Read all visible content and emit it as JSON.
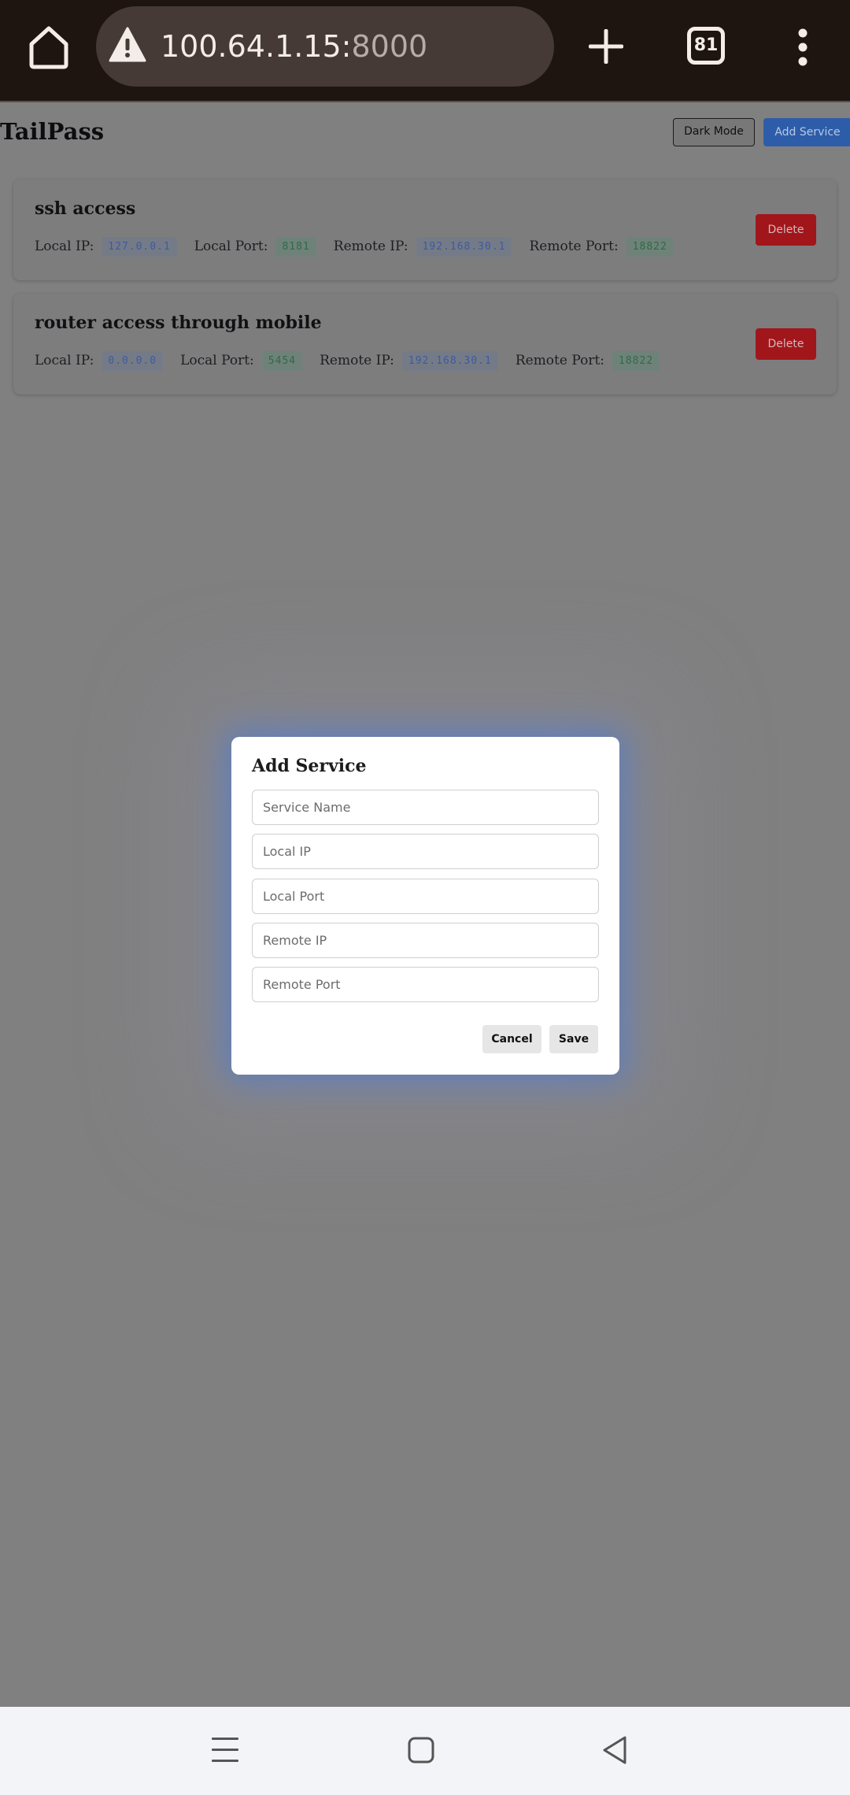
{
  "browser": {
    "url_host": "100.64.1.15:",
    "url_port": "8000",
    "tab_count": "81"
  },
  "app": {
    "title": "TailPass",
    "dark_mode_label": "Dark Mode",
    "add_service_label": "Add Service"
  },
  "services": [
    {
      "name": "ssh access",
      "local_ip_label": "Local IP:",
      "local_ip": "127.0.0.1",
      "local_port_label": "Local Port:",
      "local_port": "8181",
      "remote_ip_label": "Remote IP:",
      "remote_ip": "192.168.30.1",
      "remote_port_label": "Remote Port:",
      "remote_port": "18822",
      "delete_label": "Delete"
    },
    {
      "name": "router access through mobile",
      "local_ip_label": "Local IP:",
      "local_ip": "0.0.0.0",
      "local_port_label": "Local Port:",
      "local_port": "5454",
      "remote_ip_label": "Remote IP:",
      "remote_ip": "192.168.30.1",
      "remote_port_label": "Remote Port:",
      "remote_port": "18822",
      "delete_label": "Delete"
    }
  ],
  "modal": {
    "title": "Add Service",
    "fields": {
      "service_name": {
        "placeholder": "Service Name",
        "value": ""
      },
      "local_ip": {
        "placeholder": "Local IP",
        "value": ""
      },
      "local_port": {
        "placeholder": "Local Port",
        "value": ""
      },
      "remote_ip": {
        "placeholder": "Remote IP",
        "value": ""
      },
      "remote_port": {
        "placeholder": "Remote Port",
        "value": ""
      }
    },
    "cancel_label": "Cancel",
    "save_label": "Save"
  },
  "colors": {
    "accent": "#2d5da8",
    "danger": "#a1161b",
    "overlay": "#808081"
  },
  "icons": {
    "browser": [
      "home-icon",
      "warning-icon",
      "plus-icon",
      "tabs-icon",
      "more-vert-icon"
    ],
    "nav": [
      "recents-icon",
      "home-square-icon",
      "back-icon"
    ]
  }
}
